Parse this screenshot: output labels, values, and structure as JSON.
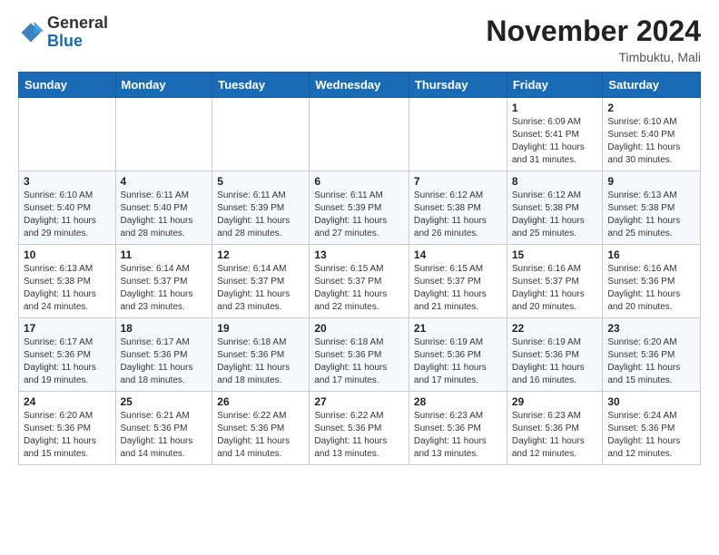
{
  "header": {
    "logo": {
      "general": "General",
      "blue": "Blue"
    },
    "title": "November 2024",
    "location": "Timbuktu, Mali"
  },
  "weekdays": [
    "Sunday",
    "Monday",
    "Tuesday",
    "Wednesday",
    "Thursday",
    "Friday",
    "Saturday"
  ],
  "weeks": [
    [
      {
        "day": "",
        "info": ""
      },
      {
        "day": "",
        "info": ""
      },
      {
        "day": "",
        "info": ""
      },
      {
        "day": "",
        "info": ""
      },
      {
        "day": "",
        "info": ""
      },
      {
        "day": "1",
        "info": "Sunrise: 6:09 AM\nSunset: 5:41 PM\nDaylight: 11 hours\nand 31 minutes."
      },
      {
        "day": "2",
        "info": "Sunrise: 6:10 AM\nSunset: 5:40 PM\nDaylight: 11 hours\nand 30 minutes."
      }
    ],
    [
      {
        "day": "3",
        "info": "Sunrise: 6:10 AM\nSunset: 5:40 PM\nDaylight: 11 hours\nand 29 minutes."
      },
      {
        "day": "4",
        "info": "Sunrise: 6:11 AM\nSunset: 5:40 PM\nDaylight: 11 hours\nand 28 minutes."
      },
      {
        "day": "5",
        "info": "Sunrise: 6:11 AM\nSunset: 5:39 PM\nDaylight: 11 hours\nand 28 minutes."
      },
      {
        "day": "6",
        "info": "Sunrise: 6:11 AM\nSunset: 5:39 PM\nDaylight: 11 hours\nand 27 minutes."
      },
      {
        "day": "7",
        "info": "Sunrise: 6:12 AM\nSunset: 5:38 PM\nDaylight: 11 hours\nand 26 minutes."
      },
      {
        "day": "8",
        "info": "Sunrise: 6:12 AM\nSunset: 5:38 PM\nDaylight: 11 hours\nand 25 minutes."
      },
      {
        "day": "9",
        "info": "Sunrise: 6:13 AM\nSunset: 5:38 PM\nDaylight: 11 hours\nand 25 minutes."
      }
    ],
    [
      {
        "day": "10",
        "info": "Sunrise: 6:13 AM\nSunset: 5:38 PM\nDaylight: 11 hours\nand 24 minutes."
      },
      {
        "day": "11",
        "info": "Sunrise: 6:14 AM\nSunset: 5:37 PM\nDaylight: 11 hours\nand 23 minutes."
      },
      {
        "day": "12",
        "info": "Sunrise: 6:14 AM\nSunset: 5:37 PM\nDaylight: 11 hours\nand 23 minutes."
      },
      {
        "day": "13",
        "info": "Sunrise: 6:15 AM\nSunset: 5:37 PM\nDaylight: 11 hours\nand 22 minutes."
      },
      {
        "day": "14",
        "info": "Sunrise: 6:15 AM\nSunset: 5:37 PM\nDaylight: 11 hours\nand 21 minutes."
      },
      {
        "day": "15",
        "info": "Sunrise: 6:16 AM\nSunset: 5:37 PM\nDaylight: 11 hours\nand 20 minutes."
      },
      {
        "day": "16",
        "info": "Sunrise: 6:16 AM\nSunset: 5:36 PM\nDaylight: 11 hours\nand 20 minutes."
      }
    ],
    [
      {
        "day": "17",
        "info": "Sunrise: 6:17 AM\nSunset: 5:36 PM\nDaylight: 11 hours\nand 19 minutes."
      },
      {
        "day": "18",
        "info": "Sunrise: 6:17 AM\nSunset: 5:36 PM\nDaylight: 11 hours\nand 18 minutes."
      },
      {
        "day": "19",
        "info": "Sunrise: 6:18 AM\nSunset: 5:36 PM\nDaylight: 11 hours\nand 18 minutes."
      },
      {
        "day": "20",
        "info": "Sunrise: 6:18 AM\nSunset: 5:36 PM\nDaylight: 11 hours\nand 17 minutes."
      },
      {
        "day": "21",
        "info": "Sunrise: 6:19 AM\nSunset: 5:36 PM\nDaylight: 11 hours\nand 17 minutes."
      },
      {
        "day": "22",
        "info": "Sunrise: 6:19 AM\nSunset: 5:36 PM\nDaylight: 11 hours\nand 16 minutes."
      },
      {
        "day": "23",
        "info": "Sunrise: 6:20 AM\nSunset: 5:36 PM\nDaylight: 11 hours\nand 15 minutes."
      }
    ],
    [
      {
        "day": "24",
        "info": "Sunrise: 6:20 AM\nSunset: 5:36 PM\nDaylight: 11 hours\nand 15 minutes."
      },
      {
        "day": "25",
        "info": "Sunrise: 6:21 AM\nSunset: 5:36 PM\nDaylight: 11 hours\nand 14 minutes."
      },
      {
        "day": "26",
        "info": "Sunrise: 6:22 AM\nSunset: 5:36 PM\nDaylight: 11 hours\nand 14 minutes."
      },
      {
        "day": "27",
        "info": "Sunrise: 6:22 AM\nSunset: 5:36 PM\nDaylight: 11 hours\nand 13 minutes."
      },
      {
        "day": "28",
        "info": "Sunrise: 6:23 AM\nSunset: 5:36 PM\nDaylight: 11 hours\nand 13 minutes."
      },
      {
        "day": "29",
        "info": "Sunrise: 6:23 AM\nSunset: 5:36 PM\nDaylight: 11 hours\nand 12 minutes."
      },
      {
        "day": "30",
        "info": "Sunrise: 6:24 AM\nSunset: 5:36 PM\nDaylight: 11 hours\nand 12 minutes."
      }
    ]
  ]
}
